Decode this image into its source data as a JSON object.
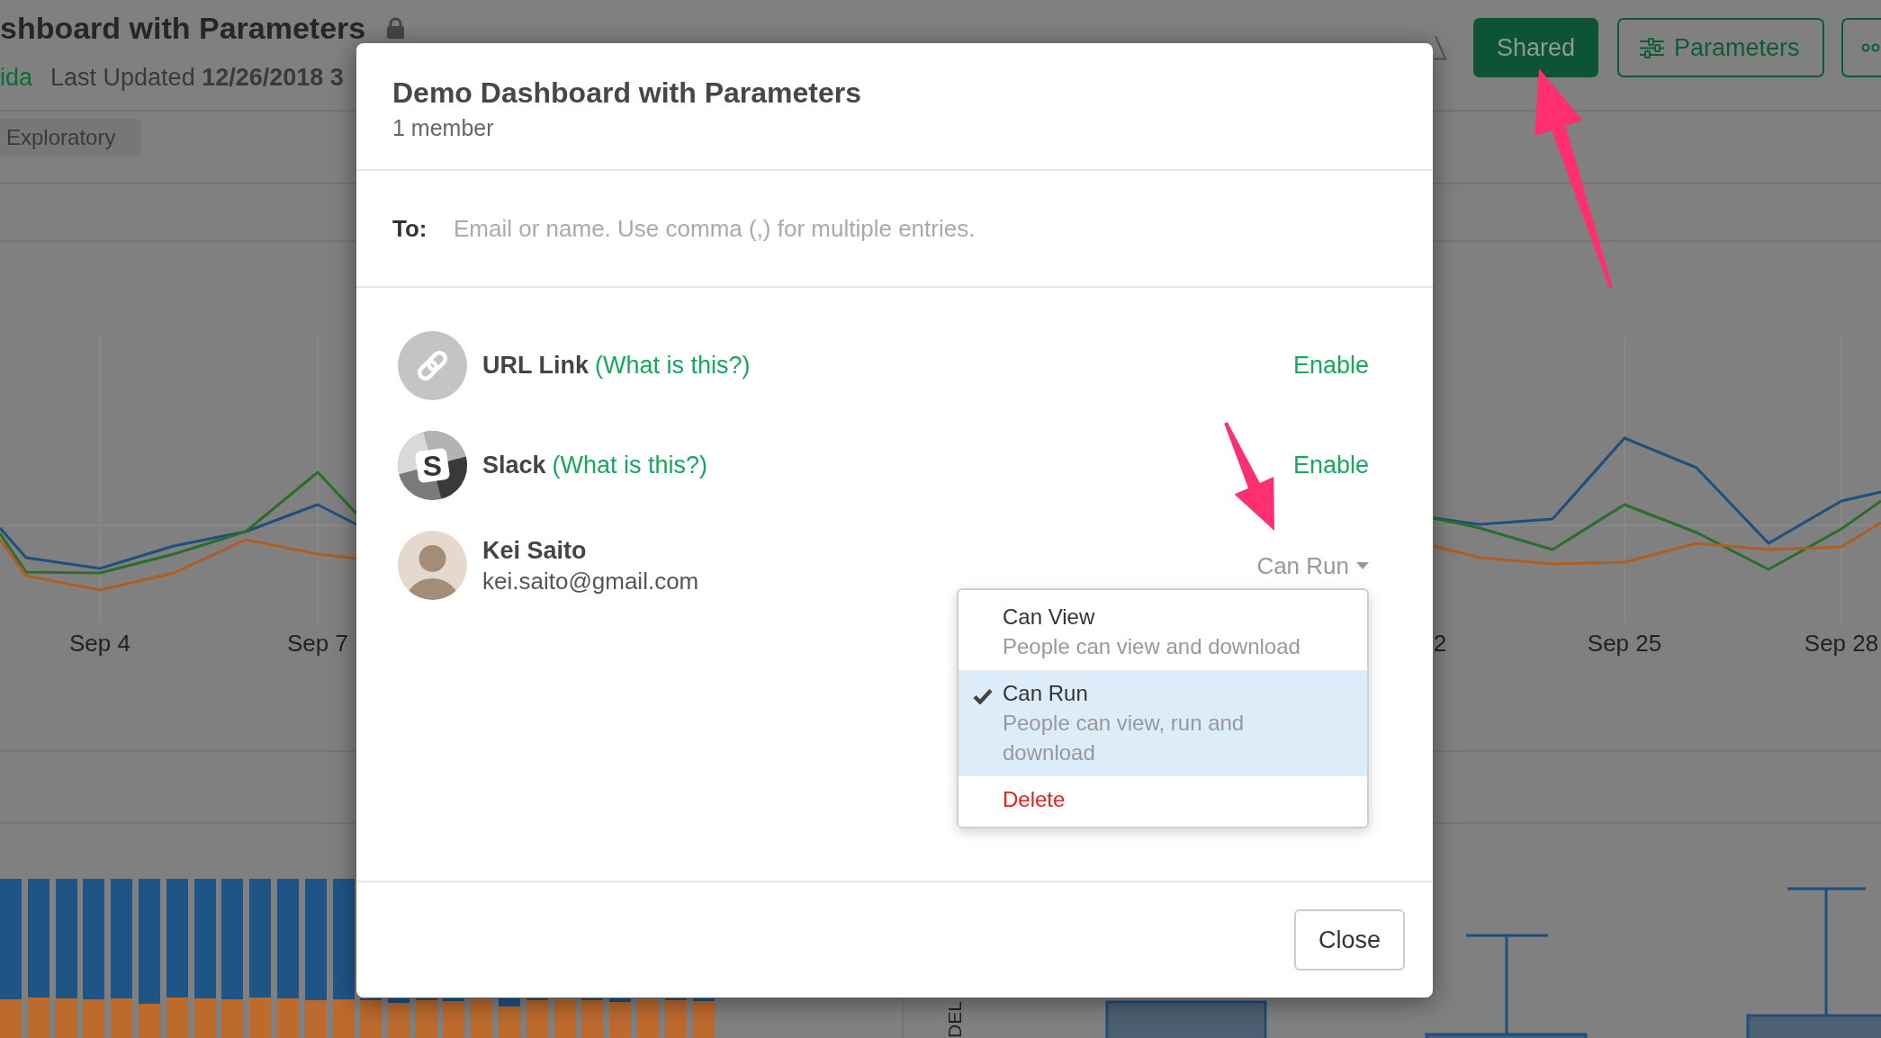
{
  "dashboard": {
    "title": "shboard with Parameters",
    "locked": true,
    "author": "ida",
    "updated": "Last Updated **12/26/2018 3**",
    "tag": "Exploratory",
    "shared_button": {
      "label": "Shared",
      "on": true
    },
    "parameters_button": {
      "label": "Parameters"
    },
    "line_chart": {
      "x_labels": [
        "Sep 4",
        "Sep 7",
        "2",
        "Sep 25",
        "Sep 28"
      ]
    },
    "box_plot": {
      "axis_label": "DEL"
    }
  },
  "dialog": {
    "title": "Demo Dashboard with Parameters",
    "subtitle": "1 member",
    "to_field": {
      "label": "To:",
      "placeholder": "Email or name. Use comma (,) for multiple entries."
    },
    "integrations": [
      {
        "kind": "url",
        "name": "URL Link",
        "help": "(What is this?)",
        "action": "Enable"
      },
      {
        "kind": "slack",
        "icon_letter": "S",
        "name": "Slack",
        "help": "(What is this?)",
        "action": "Enable"
      }
    ],
    "members": [
      {
        "name": "Kei Saito",
        "email": "kei.saito@gmail.com",
        "permission": "Can Run",
        "menu_open": true,
        "menu": [
          {
            "kind": "option",
            "label": "Can View",
            "description": "People can view and download",
            "selected": false
          },
          {
            "kind": "option",
            "label": "Can Run",
            "description": "People can view, run and download",
            "selected": true
          },
          {
            "kind": "danger",
            "label": "Delete",
            "selected": false
          }
        ]
      }
    ],
    "close_button": "Close"
  }
}
